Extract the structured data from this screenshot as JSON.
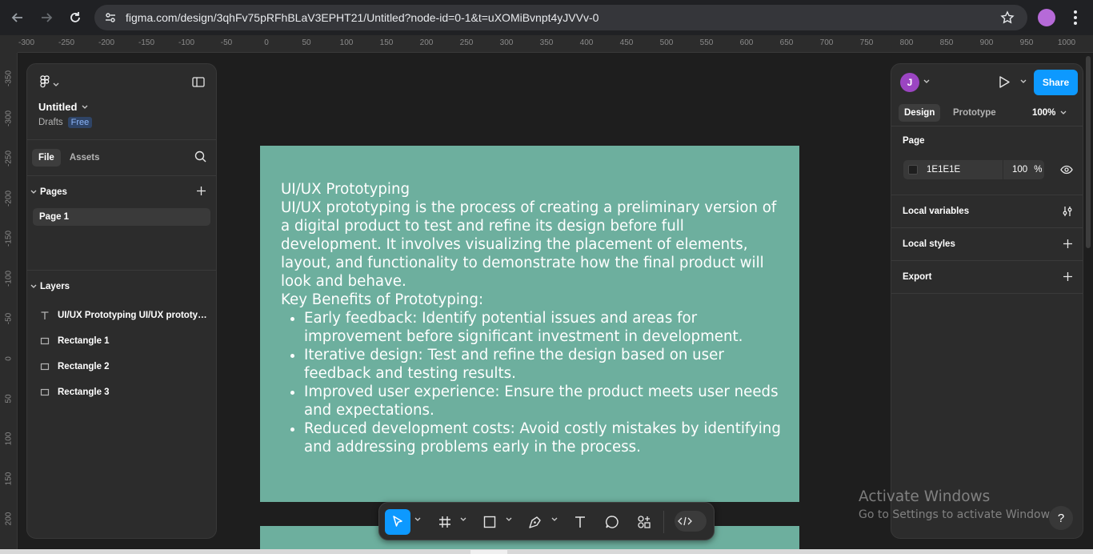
{
  "browser": {
    "url": "figma.com/design/3qhFv75pRFhBLaV3EPHT21/Untitled?node-id=0-1&t=uXOMiBvnpt4yJVVv-0",
    "icons": [
      "back-icon",
      "forward-icon",
      "reload-icon",
      "site-settings-icon",
      "bookmark-star-icon",
      "profile-icon",
      "menu-icon"
    ]
  },
  "rulers": {
    "top": [
      "-300",
      "-250",
      "-200",
      "-150",
      "-100",
      "-50",
      "0",
      "50",
      "100",
      "150",
      "200",
      "250",
      "300",
      "350",
      "400",
      "450",
      "500",
      "550",
      "600",
      "650",
      "700",
      "750",
      "800",
      "850",
      "900",
      "950",
      "1000"
    ],
    "left": [
      "-350",
      "-300",
      "-250",
      "-200",
      "-150",
      "-100",
      "-50",
      "0",
      "50",
      "100",
      "150",
      "200"
    ]
  },
  "left_panel": {
    "file_name": "Untitled",
    "location": "Drafts",
    "plan_badge": "Free",
    "tabs": [
      "File",
      "Assets"
    ],
    "pages_header": "Pages",
    "pages": [
      "Page 1"
    ],
    "layers_header": "Layers",
    "layers": [
      {
        "name": "UI/UX Prototyping UI/UX prototyp...",
        "type": "text"
      },
      {
        "name": "Rectangle 1",
        "type": "rectangle"
      },
      {
        "name": "Rectangle 2",
        "type": "rectangle"
      },
      {
        "name": "Rectangle 3",
        "type": "rectangle"
      }
    ]
  },
  "canvas": {
    "frame_color": "#6daf9e",
    "heading": "UI/UX Prototyping",
    "intro": "UI/UX prototyping is the process of creating a preliminary version of a digital product to test and refine its design before full development. It involves visualizing the placement of elements, layout, and functionality to demonstrate how the final product will look and behave.",
    "benefits_title": "Key Benefits of Prototyping:",
    "benefits": [
      "Early feedback: Identify potential issues and areas for improvement before significant investment in development.",
      "Iterative design: Test and refine the design based on user feedback and testing results.",
      "Improved user experience: Ensure the product meets user needs and expectations.",
      "Reduced development costs: Avoid costly mistakes by identifying and addressing problems early in the process."
    ]
  },
  "toolbar": {
    "tools": [
      "move-tool",
      "frame-tool",
      "rectangle-tool",
      "pen-tool",
      "text-tool",
      "comment-tool",
      "actions-tool",
      "dev-mode-toggle"
    ]
  },
  "right_panel": {
    "avatar_initial": "J",
    "share_label": "Share",
    "tabs": [
      "Design",
      "Prototype"
    ],
    "zoom": "100%",
    "page_section_title": "Page",
    "page_color_hex": "1E1E1E",
    "page_opacity": "100",
    "page_opacity_unit": "%",
    "rows": [
      "Local variables",
      "Local styles",
      "Export"
    ],
    "accent_color": "#0d99ff"
  },
  "overlay": {
    "activate_title": "Activate Windows",
    "activate_sub": "Go to Settings to activate Windows.",
    "help": "?"
  }
}
